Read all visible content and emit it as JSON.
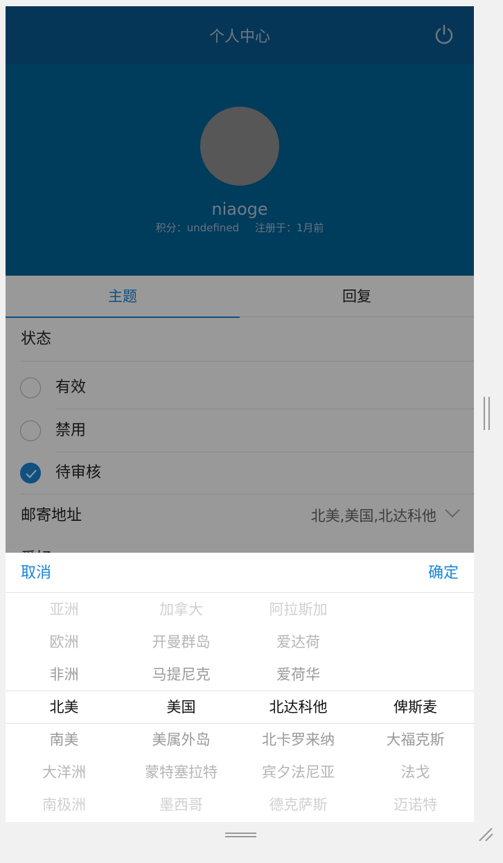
{
  "header": {
    "title": "个人中心",
    "power_icon": "power-icon"
  },
  "profile": {
    "username": "niaoge",
    "points": "积分：undefined",
    "registered": "注册于：1月前"
  },
  "tabs": [
    {
      "label": "主题",
      "active": true
    },
    {
      "label": "回复",
      "active": false
    }
  ],
  "form": {
    "status_label": "状态",
    "options": [
      {
        "label": "有效",
        "checked": false
      },
      {
        "label": "禁用",
        "checked": false
      },
      {
        "label": "待审核",
        "checked": true
      }
    ],
    "address_label": "邮寄地址",
    "address_value": "北美,美国,北达科他",
    "hobby_label": "爱好"
  },
  "picker": {
    "cancel_label": "取消",
    "confirm_label": "确定",
    "columns": [
      [
        "亚洲",
        "欧洲",
        "非洲",
        "北美",
        "南美",
        "大洋洲",
        "南极洲"
      ],
      [
        "加拿大",
        "开曼群岛",
        "马提尼克",
        "美国",
        "美属外岛",
        "蒙特塞拉特",
        "墨西哥"
      ],
      [
        "阿拉斯加",
        "爱达荷",
        "爱荷华",
        "北达科他",
        "北卡罗来纳",
        "宾夕法尼亚",
        "德克萨斯"
      ],
      [
        "",
        "",
        "",
        "俾斯麦",
        "大福克斯",
        "法戈",
        "迈诺特"
      ]
    ],
    "selected_index": 3
  },
  "colors": {
    "accent": "#1a85d6",
    "header_bg": "#0b5a92",
    "profile_bg": "#00659a"
  }
}
